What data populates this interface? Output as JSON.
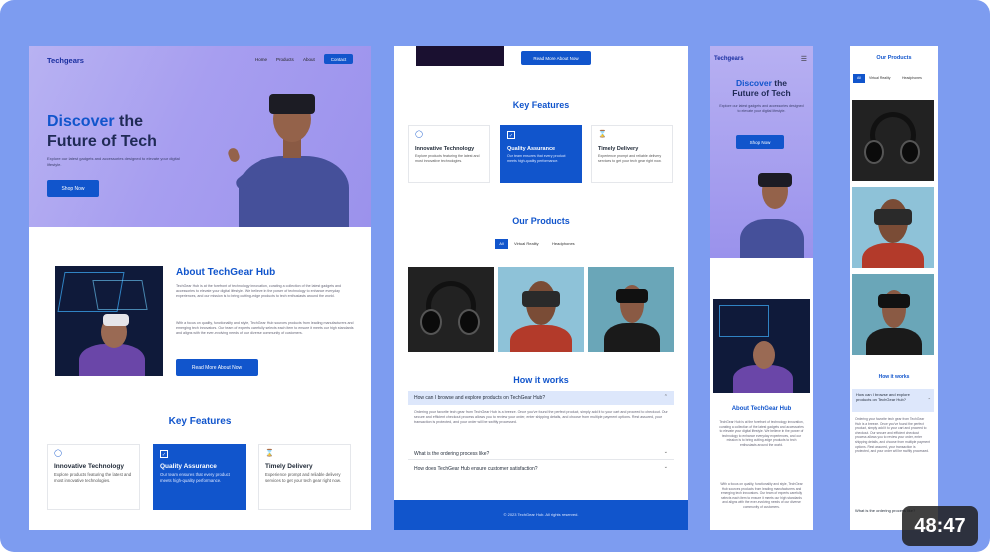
{
  "brand": "Techgears",
  "nav": {
    "home": "Home",
    "products": "Products",
    "about": "About",
    "contact": "Contact"
  },
  "hero": {
    "title_accent": "Discover",
    "title_rest": " the",
    "title_line2": "Future of Tech",
    "subtitle": "Explore our latest gadgets and accessories designed to elevate your digital lifestyle.",
    "cta": "Shop Now"
  },
  "about": {
    "title": "About TechGear Hub",
    "p1": "TechGear Hub is at the forefront of technology innovation, curating a collection of the latest gadgets and accessories to elevate your digital lifestyle. We believe in the power of technology to enhance everyday experiences, and our mission is to bring cutting-edge products to tech enthusiasts around the world.",
    "p2": "With a focus on quality, functionality and style, TechGear Hub sources products from leading manufacturers and emerging tech innovators. Our team of experts carefully selects each item to ensure it meets our high standards and aligns with the ever-evolving needs of our diverse community of customers.",
    "cta": "Read More About Now"
  },
  "features": {
    "title": "Key Features",
    "items": [
      {
        "title": "Innovative Technology",
        "desc": "Explore products featuring the latest and most innovative technologies.",
        "icon": "lightbulb-icon"
      },
      {
        "title": "Quality Assurance",
        "desc": "Our team ensures that every product meets high-quality performance.",
        "icon": "shield-icon"
      },
      {
        "title": "Timely Delivery",
        "desc": "Experience prompt and reliable delivery services to get your tech gear right now.",
        "icon": "hourglass-icon"
      }
    ]
  },
  "products": {
    "title": "Our Products",
    "tabs": [
      "All",
      "Virtual Reality",
      "Headphones"
    ]
  },
  "faq": {
    "title": "How it works",
    "q1": "How can I browse and explore products on TechGear Hub?",
    "a1": "Ordering your favorite tech gear from TechGear Hub is a breeze. Once you've found the perfect product, simply add it to your cart and proceed to checkout. Our secure and efficient checkout process allows you to review your order, enter shipping details, and choose from multiple payment options. Rest assured, your transaction is protected, and your order will be swiftly processed.",
    "q2": "What is the ordering process like?",
    "q3": "How does TechGear Hub ensure customer satisfaction?"
  },
  "footer": "© 2023 TechGear Hub. All rights reserved.",
  "mobile": {
    "hero_title": "Discover the Future of Tech",
    "hero_title_rest": "the Future of Tech",
    "q1": "How can I browse and explore products on TechGear Hub?",
    "q2_part": "What is the ordering process like?"
  },
  "video_duration": "48:47"
}
